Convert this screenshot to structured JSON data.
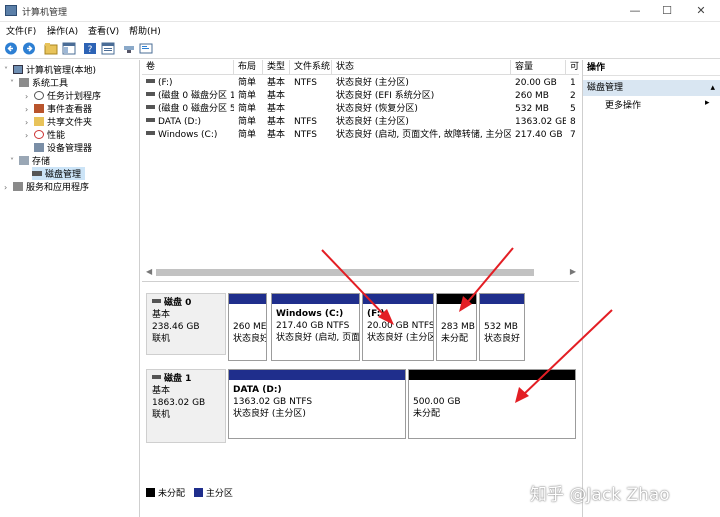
{
  "window": {
    "title": "计算机管理"
  },
  "menu": [
    "文件(F)",
    "操作(A)",
    "查看(V)",
    "帮助(H)"
  ],
  "tree": {
    "root": "计算机管理(本地)",
    "system_tools": "系统工具",
    "task_scheduler": "任务计划程序",
    "event_viewer": "事件查看器",
    "shared_folders": "共享文件夹",
    "performance": "性能",
    "device_manager": "设备管理器",
    "storage": "存储",
    "disk_management": "磁盘管理",
    "services_apps": "服务和应用程序"
  },
  "volume_table": {
    "headers": [
      "卷",
      "布局",
      "类型",
      "文件系统",
      "状态",
      "容量",
      "可"
    ],
    "rows": [
      [
        "(F:)",
        "简单",
        "基本",
        "NTFS",
        "状态良好 (主分区)",
        "20.00 GB",
        "1"
      ],
      [
        "(磁盘 0 磁盘分区 1)",
        "简单",
        "基本",
        "",
        "状态良好 (EFI 系统分区)",
        "260 MB",
        "2"
      ],
      [
        "(磁盘 0 磁盘分区 5)",
        "简单",
        "基本",
        "",
        "状态良好 (恢复分区)",
        "532 MB",
        "5"
      ],
      [
        "DATA (D:)",
        "简单",
        "基本",
        "NTFS",
        "状态良好 (主分区)",
        "1363.02 GB",
        "8"
      ],
      [
        "Windows (C:)",
        "简单",
        "基本",
        "NTFS",
        "状态良好 (启动, 页面文件, 故障转储, 主分区)",
        "217.40 GB",
        "7"
      ]
    ]
  },
  "disk0": {
    "name": "磁盘 0",
    "type": "基本",
    "size": "238.46 GB",
    "status": "联机",
    "parts": [
      {
        "name": "",
        "size": "260 ME",
        "status": "状态良好"
      },
      {
        "name": "Windows  (C:)",
        "size": "217.40 GB NTFS",
        "status": "状态良好 (启动, 页面"
      },
      {
        "name": "(F:)",
        "size": "20.00 GB NTFS",
        "status": "状态良好 (主分区"
      },
      {
        "name": "",
        "size": "283 MB",
        "status": "未分配"
      },
      {
        "name": "",
        "size": "532 MB",
        "status": "状态良好"
      }
    ]
  },
  "disk1": {
    "name": "磁盘 1",
    "type": "基本",
    "size": "1863.02 GB",
    "status": "联机",
    "parts": [
      {
        "name": "DATA  (D:)",
        "size": "1363.02 GB NTFS",
        "status": "状态良好 (主分区)"
      },
      {
        "name": "",
        "size": "500.00 GB",
        "status": "未分配"
      }
    ]
  },
  "legend": {
    "unallocated": "未分配",
    "primary": "主分区"
  },
  "colors": {
    "primary": "#1f2e8c",
    "unallocated": "#000000"
  },
  "actions": {
    "title": "操作",
    "section": "磁盘管理",
    "more": "更多操作"
  },
  "watermark": "知乎 @Jack Zhao"
}
